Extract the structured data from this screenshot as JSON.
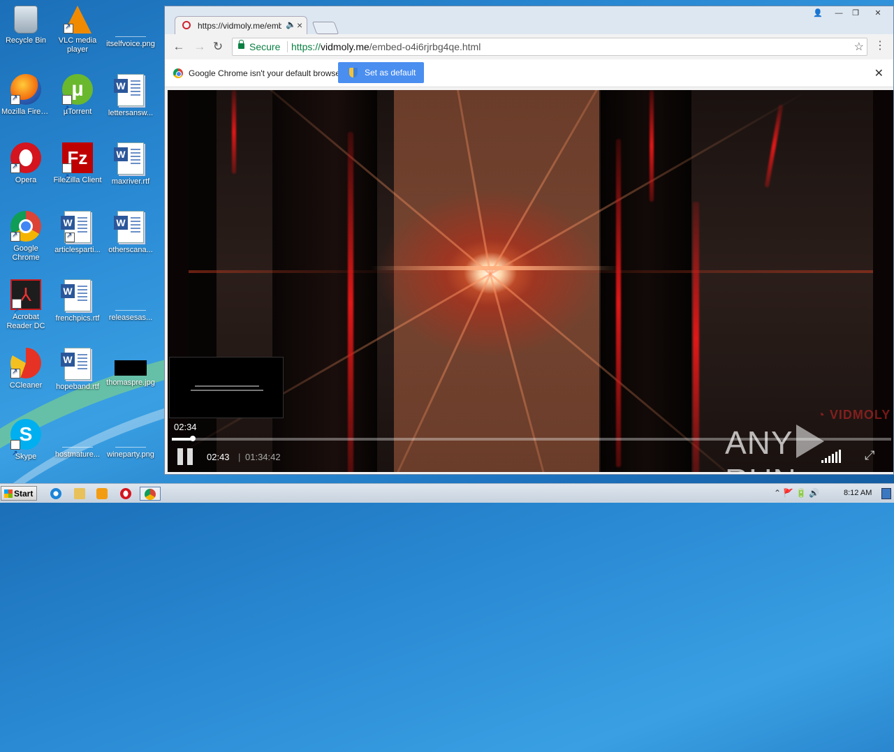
{
  "desktop": {
    "icons": [
      {
        "label": "Recycle Bin"
      },
      {
        "label": "VLC media player"
      },
      {
        "label": "itselfvoice.png"
      },
      {
        "label": "Mozilla Firefox"
      },
      {
        "label": "µTorrent"
      },
      {
        "label": "lettersansw..."
      },
      {
        "label": "Opera"
      },
      {
        "label": "FileZilla Client"
      },
      {
        "label": "maxriver.rtf"
      },
      {
        "label": "Google Chrome"
      },
      {
        "label": "articlesparti..."
      },
      {
        "label": "otherscana..."
      },
      {
        "label": "Acrobat Reader DC"
      },
      {
        "label": "frenchpics.rtf"
      },
      {
        "label": "releasesas..."
      },
      {
        "label": "CCleaner"
      },
      {
        "label": "hopeband.rtf"
      },
      {
        "label": "thomaspre.jpg"
      },
      {
        "label": "Skype"
      },
      {
        "label": "hostmature..."
      },
      {
        "label": "wineparty.png"
      }
    ]
  },
  "browser": {
    "tab_title": "https://vidmoly.me/emb",
    "tab_audio_icon": "speaker-icon",
    "address": {
      "secure_label": "Secure",
      "url_proto": "https://",
      "url_host": "vidmoly.me",
      "url_path": "/embed-o4i6rjrbg4qe.html"
    },
    "infobar": {
      "message": "Google Chrome isn't your default browser.",
      "button_label": "Set as default"
    }
  },
  "player": {
    "hover_time": "02:34",
    "current_time": "02:43",
    "divider": "|",
    "duration": "01:34:42",
    "progress_fraction": 0.029,
    "logo_text": "VIDMOLY"
  },
  "watermark": {
    "left": "ANY",
    "right": "RUN"
  },
  "taskbar": {
    "start_label": "Start",
    "clock": "8:12 AM"
  }
}
